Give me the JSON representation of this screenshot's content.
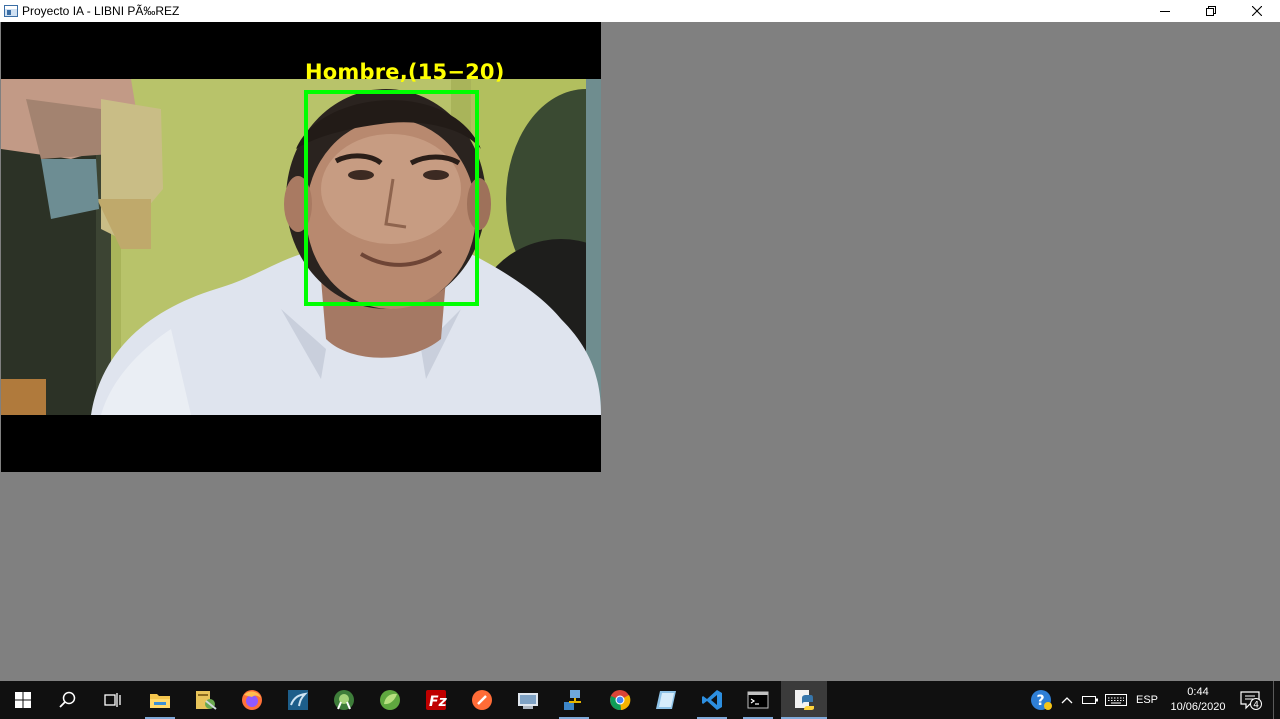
{
  "window": {
    "title": "Proyecto IA - LIBNI PÃ‰REZ",
    "controls": [
      "minimize-icon",
      "restore-icon",
      "close-icon"
    ]
  },
  "detection": {
    "label": "Hombre,(15−20)",
    "box_color": "#00ff00",
    "label_color": "#ffff00"
  },
  "taskbar": {
    "apps": [
      {
        "name": "start-icon"
      },
      {
        "name": "search-icon"
      },
      {
        "name": "task-view-icon"
      },
      {
        "name": "file-explorer-icon"
      },
      {
        "name": "tools-app-icon"
      },
      {
        "name": "firefox-icon"
      },
      {
        "name": "mysql-workbench-icon"
      },
      {
        "name": "android-studio-icon"
      },
      {
        "name": "spring-tool-icon"
      },
      {
        "name": "filezilla-icon"
      },
      {
        "name": "postman-icon"
      },
      {
        "name": "vm-app-icon"
      },
      {
        "name": "network-app-icon"
      },
      {
        "name": "chrome-icon"
      },
      {
        "name": "notes-app-icon"
      },
      {
        "name": "vscode-icon"
      },
      {
        "name": "terminal-icon"
      },
      {
        "name": "python-icon"
      }
    ],
    "tray": {
      "language": "ESP",
      "time": "0:44",
      "date": "10/06/2020",
      "notification_count": "4"
    }
  }
}
